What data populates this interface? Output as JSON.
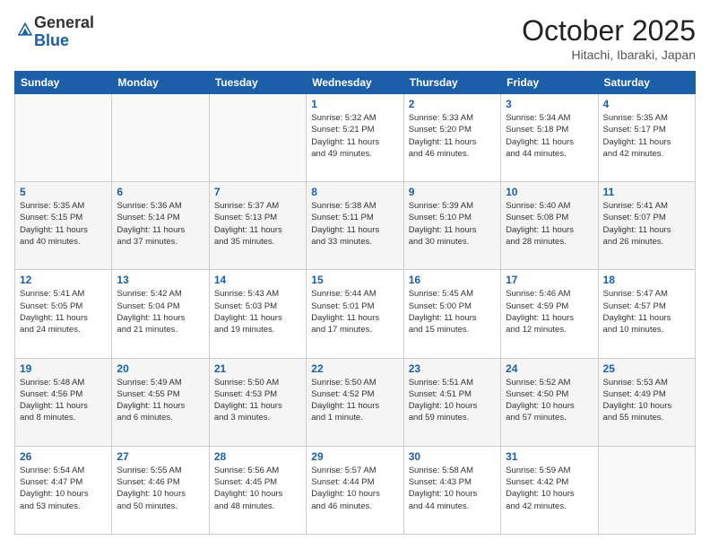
{
  "header": {
    "logo_general": "General",
    "logo_blue": "Blue",
    "month_title": "October 2025",
    "location": "Hitachi, Ibaraki, Japan"
  },
  "weekdays": [
    "Sunday",
    "Monday",
    "Tuesday",
    "Wednesday",
    "Thursday",
    "Friday",
    "Saturday"
  ],
  "weeks": [
    [
      {
        "day": "",
        "info": ""
      },
      {
        "day": "",
        "info": ""
      },
      {
        "day": "",
        "info": ""
      },
      {
        "day": "1",
        "info": "Sunrise: 5:32 AM\nSunset: 5:21 PM\nDaylight: 11 hours\nand 49 minutes."
      },
      {
        "day": "2",
        "info": "Sunrise: 5:33 AM\nSunset: 5:20 PM\nDaylight: 11 hours\nand 46 minutes."
      },
      {
        "day": "3",
        "info": "Sunrise: 5:34 AM\nSunset: 5:18 PM\nDaylight: 11 hours\nand 44 minutes."
      },
      {
        "day": "4",
        "info": "Sunrise: 5:35 AM\nSunset: 5:17 PM\nDaylight: 11 hours\nand 42 minutes."
      }
    ],
    [
      {
        "day": "5",
        "info": "Sunrise: 5:35 AM\nSunset: 5:15 PM\nDaylight: 11 hours\nand 40 minutes."
      },
      {
        "day": "6",
        "info": "Sunrise: 5:36 AM\nSunset: 5:14 PM\nDaylight: 11 hours\nand 37 minutes."
      },
      {
        "day": "7",
        "info": "Sunrise: 5:37 AM\nSunset: 5:13 PM\nDaylight: 11 hours\nand 35 minutes."
      },
      {
        "day": "8",
        "info": "Sunrise: 5:38 AM\nSunset: 5:11 PM\nDaylight: 11 hours\nand 33 minutes."
      },
      {
        "day": "9",
        "info": "Sunrise: 5:39 AM\nSunset: 5:10 PM\nDaylight: 11 hours\nand 30 minutes."
      },
      {
        "day": "10",
        "info": "Sunrise: 5:40 AM\nSunset: 5:08 PM\nDaylight: 11 hours\nand 28 minutes."
      },
      {
        "day": "11",
        "info": "Sunrise: 5:41 AM\nSunset: 5:07 PM\nDaylight: 11 hours\nand 26 minutes."
      }
    ],
    [
      {
        "day": "12",
        "info": "Sunrise: 5:41 AM\nSunset: 5:05 PM\nDaylight: 11 hours\nand 24 minutes."
      },
      {
        "day": "13",
        "info": "Sunrise: 5:42 AM\nSunset: 5:04 PM\nDaylight: 11 hours\nand 21 minutes."
      },
      {
        "day": "14",
        "info": "Sunrise: 5:43 AM\nSunset: 5:03 PM\nDaylight: 11 hours\nand 19 minutes."
      },
      {
        "day": "15",
        "info": "Sunrise: 5:44 AM\nSunset: 5:01 PM\nDaylight: 11 hours\nand 17 minutes."
      },
      {
        "day": "16",
        "info": "Sunrise: 5:45 AM\nSunset: 5:00 PM\nDaylight: 11 hours\nand 15 minutes."
      },
      {
        "day": "17",
        "info": "Sunrise: 5:46 AM\nSunset: 4:59 PM\nDaylight: 11 hours\nand 12 minutes."
      },
      {
        "day": "18",
        "info": "Sunrise: 5:47 AM\nSunset: 4:57 PM\nDaylight: 11 hours\nand 10 minutes."
      }
    ],
    [
      {
        "day": "19",
        "info": "Sunrise: 5:48 AM\nSunset: 4:56 PM\nDaylight: 11 hours\nand 8 minutes."
      },
      {
        "day": "20",
        "info": "Sunrise: 5:49 AM\nSunset: 4:55 PM\nDaylight: 11 hours\nand 6 minutes."
      },
      {
        "day": "21",
        "info": "Sunrise: 5:50 AM\nSunset: 4:53 PM\nDaylight: 11 hours\nand 3 minutes."
      },
      {
        "day": "22",
        "info": "Sunrise: 5:50 AM\nSunset: 4:52 PM\nDaylight: 11 hours\nand 1 minute."
      },
      {
        "day": "23",
        "info": "Sunrise: 5:51 AM\nSunset: 4:51 PM\nDaylight: 10 hours\nand 59 minutes."
      },
      {
        "day": "24",
        "info": "Sunrise: 5:52 AM\nSunset: 4:50 PM\nDaylight: 10 hours\nand 57 minutes."
      },
      {
        "day": "25",
        "info": "Sunrise: 5:53 AM\nSunset: 4:49 PM\nDaylight: 10 hours\nand 55 minutes."
      }
    ],
    [
      {
        "day": "26",
        "info": "Sunrise: 5:54 AM\nSunset: 4:47 PM\nDaylight: 10 hours\nand 53 minutes."
      },
      {
        "day": "27",
        "info": "Sunrise: 5:55 AM\nSunset: 4:46 PM\nDaylight: 10 hours\nand 50 minutes."
      },
      {
        "day": "28",
        "info": "Sunrise: 5:56 AM\nSunset: 4:45 PM\nDaylight: 10 hours\nand 48 minutes."
      },
      {
        "day": "29",
        "info": "Sunrise: 5:57 AM\nSunset: 4:44 PM\nDaylight: 10 hours\nand 46 minutes."
      },
      {
        "day": "30",
        "info": "Sunrise: 5:58 AM\nSunset: 4:43 PM\nDaylight: 10 hours\nand 44 minutes."
      },
      {
        "day": "31",
        "info": "Sunrise: 5:59 AM\nSunset: 4:42 PM\nDaylight: 10 hours\nand 42 minutes."
      },
      {
        "day": "",
        "info": ""
      }
    ]
  ]
}
